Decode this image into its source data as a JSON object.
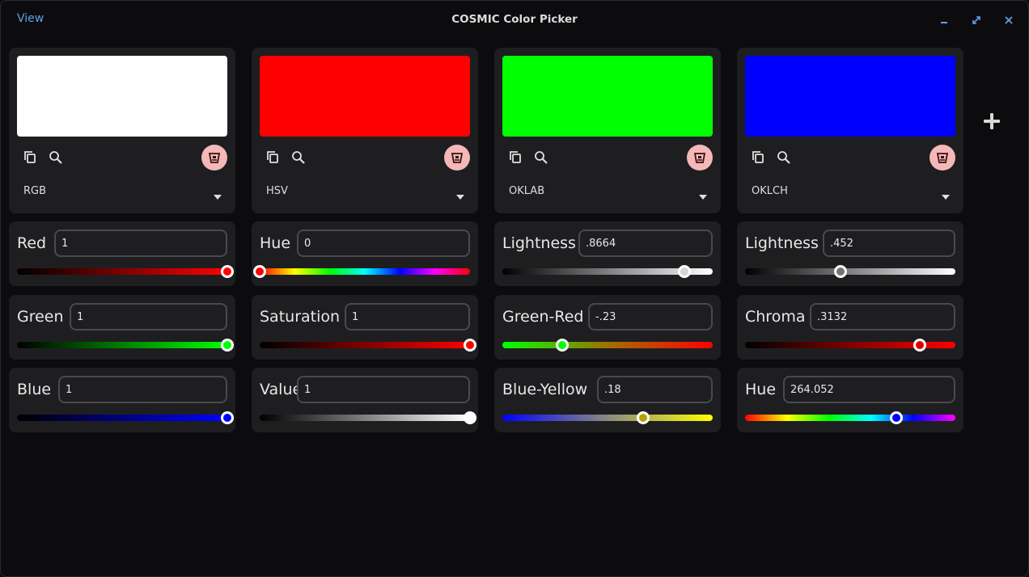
{
  "window": {
    "title": "COSMIC Color Picker",
    "menu_view": "View",
    "controls": [
      "minimize-icon",
      "maximize-icon",
      "close-icon"
    ]
  },
  "columns": [
    {
      "model": "RGB",
      "swatch_color": "#ffffff",
      "channels": [
        {
          "label": "Red",
          "value": "1",
          "level": 1.0
        },
        {
          "label": "Green",
          "value": "1",
          "level": 1.0
        },
        {
          "label": "Blue",
          "value": "1",
          "level": 1.0
        }
      ]
    },
    {
      "model": "HSV",
      "swatch_color": "#ff0000",
      "channels": [
        {
          "label": "Hue",
          "value": "0",
          "level": 0.0
        },
        {
          "label": "Saturation",
          "value": "1",
          "level": 1.0
        },
        {
          "label": "Value",
          "value": "1",
          "level": 1.0
        }
      ]
    },
    {
      "model": "OKLAB",
      "swatch_color": "#00ff00",
      "channels": [
        {
          "label": "Lightness",
          "value": ".8664",
          "level": 0.8664
        },
        {
          "label": "Green-Red",
          "value": "-.23",
          "level": 0.285
        },
        {
          "label": "Blue-Yellow",
          "value": ".18",
          "level": 0.67
        }
      ]
    },
    {
      "model": "OKLCH",
      "swatch_color": "#0000ff",
      "channels": [
        {
          "label": "Lightness",
          "value": ".452",
          "level": 0.452
        },
        {
          "label": "Chroma",
          "value": ".3132",
          "level": 0.83
        },
        {
          "label": "Hue",
          "value": "264.052",
          "level": 0.72
        }
      ]
    }
  ],
  "toolbar_icons": [
    "copy-icon",
    "search-icon",
    "delete-icon"
  ],
  "add_icon": "plus-icon",
  "colors": {
    "accent": "#62a0ea",
    "card": "#1e1e21",
    "background": "#0c0c0e",
    "delete_button": "#f4b8b8"
  }
}
